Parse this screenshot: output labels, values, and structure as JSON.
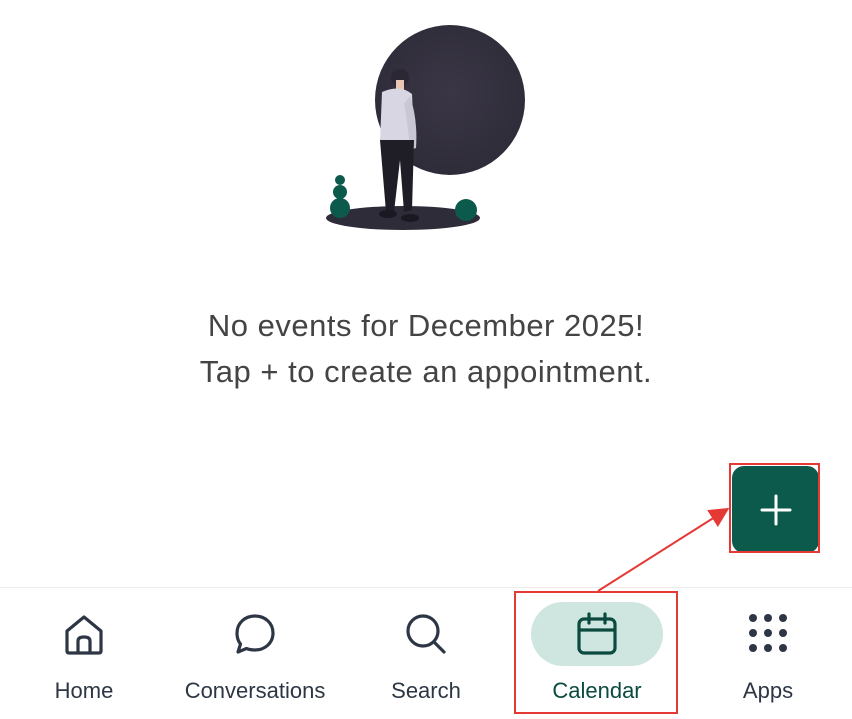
{
  "empty_state": {
    "line1": "No events for December 2025!",
    "line2": "Tap + to create an appointment."
  },
  "fab": {
    "icon": "plus-icon",
    "color": "#0b5a4b"
  },
  "bottom_nav": {
    "items": [
      {
        "label": "Home",
        "icon": "home-icon",
        "active": false
      },
      {
        "label": "Conversations",
        "icon": "chat-bubble-icon",
        "active": false
      },
      {
        "label": "Search",
        "icon": "search-icon",
        "active": false
      },
      {
        "label": "Calendar",
        "icon": "calendar-icon",
        "active": true
      },
      {
        "label": "Apps",
        "icon": "apps-grid-icon",
        "active": false
      }
    ],
    "active_pill_color": "#cfe5e0"
  },
  "annotations": {
    "highlight_color": "#e53935"
  }
}
